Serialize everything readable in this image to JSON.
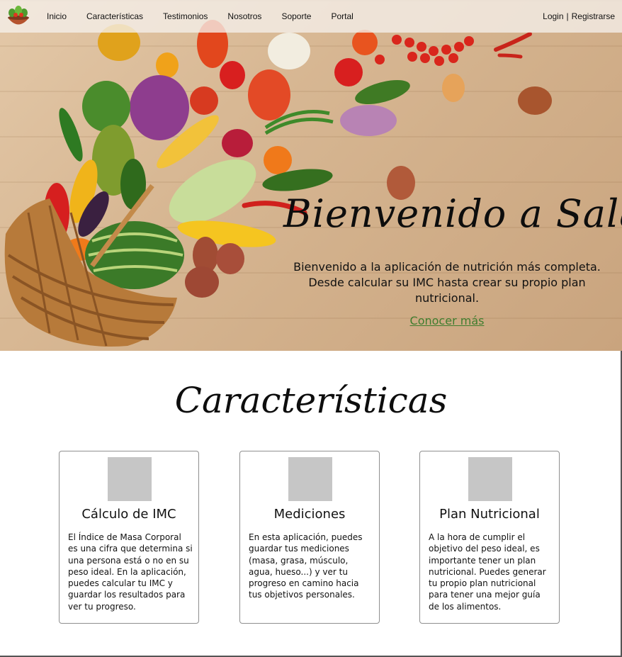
{
  "nav": {
    "links": [
      "Inicio",
      "Características",
      "Testimonios",
      "Nosotros",
      "Soporte",
      "Portal"
    ],
    "login": "Login",
    "separator": "|",
    "register": "Registrarse",
    "logo_icon": "salad-bowl-icon"
  },
  "hero": {
    "title": "Bienvenido a Salad",
    "subtitle": "Bienvenido a la aplicación de nutrición más completa. Desde calcular su IMC hasta crear su propio plan nutricional.",
    "cta": "Conocer más",
    "cta_color": "#3f7d2e",
    "background_image": "vegetables-basket-on-wood"
  },
  "features": {
    "title": "Características",
    "cards": [
      {
        "title": "Cálculo de IMC",
        "text": "El Índice de Masa Corporal es una cifra que determina si una persona está o no en su peso ideal. En la aplicación, puedes calcular tu IMC y guardar los resultados para ver tu progreso."
      },
      {
        "title": "Mediciones",
        "text": "En esta aplicación, puedes guardar tus mediciones (masa, grasa, músculo, agua, hueso...) y ver tu progreso en camino hacia tus objetivos personales."
      },
      {
        "title": "Plan Nutricional",
        "text": "A la hora de cumplir el objetivo del peso ideal, es importante tener un plan nutricional. Puedes generar tu propio plan nutricional para tener una mejor guía de los alimentos."
      }
    ]
  }
}
